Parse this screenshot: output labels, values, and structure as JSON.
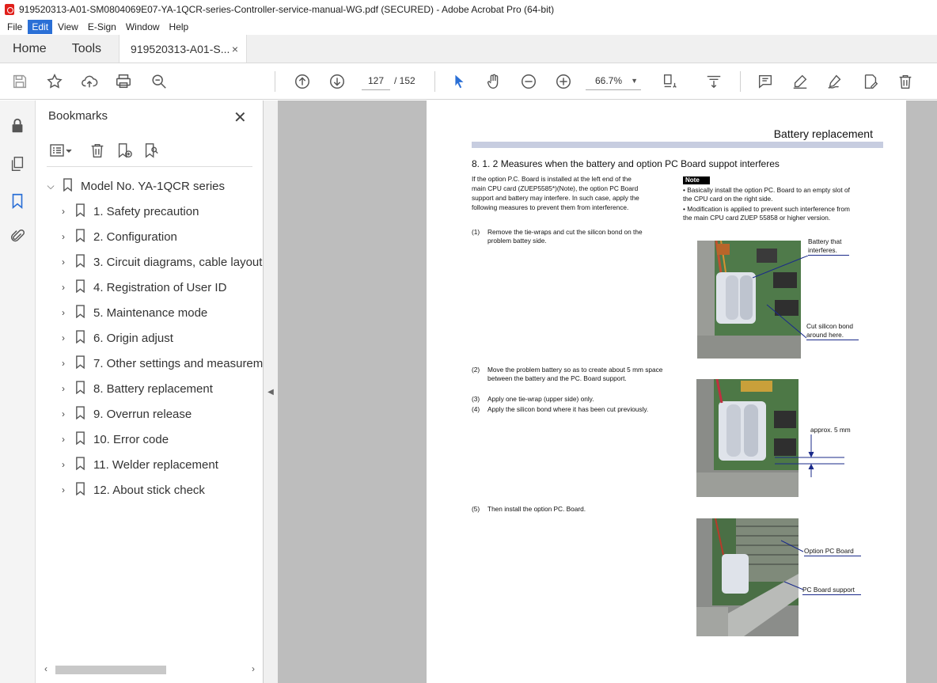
{
  "window": {
    "title": "919520313-A01-SM0804069E07-YA-1QCR-series-Controller-service-manual-WG.pdf (SECURED) - Adobe Acrobat Pro (64-bit)"
  },
  "menu": {
    "items": [
      "File",
      "Edit",
      "View",
      "E-Sign",
      "Window",
      "Help"
    ]
  },
  "tabs": {
    "home": "Home",
    "tools": "Tools",
    "document": "919520313-A01-S...",
    "close": "×"
  },
  "toolbar": {
    "page_current": "127",
    "page_total": "/  152",
    "zoom": "66.7%"
  },
  "bookmarks_panel": {
    "title": "Bookmarks",
    "close": "✕",
    "root": "Model No. YA-1QCR series",
    "items": [
      "1. Safety precaution",
      "2. Configuration",
      "3. Circuit diagrams, cable layout",
      "4. Registration of User ID",
      "5. Maintenance mode",
      "6. Origin adjust",
      "7. Other settings and measurem",
      "8. Battery replacement",
      "9. Overrun release",
      "10. Error code",
      "11. Welder replacement",
      "12. About stick check"
    ]
  },
  "pdf_page": {
    "header": "Battery replacement",
    "section": "8. 1. 2  Measures when the battery and option PC Board suppot interferes",
    "intro_lines": [
      "If the option P.C. Board is installed at the left end of the",
      "main CPU card (ZUEP5585*)(Note), the option PC Board",
      "support and battery may interfere. In such case, apply the",
      "following measures to prevent them from interference."
    ],
    "note_label": "Note",
    "note_lines": [
      "• Basically install the option PC. Board to an empty slot  of",
      "   the CPU card on the right side.",
      "• Modification is applied to prevent such interference from",
      "   the main CPU card ZUEP 55858 or higher version."
    ],
    "steps": [
      {
        "num": "(1)",
        "text": "Remove the tie-wraps and cut the silicon bond on the problem battey side."
      },
      {
        "num": "(2)",
        "text": "Move the problem battery so as to create about 5 mm space between the battery and the PC. Board support."
      },
      {
        "num": "(3)",
        "text": "Apply one tie-wrap (upper side) only."
      },
      {
        "num": "(4)",
        "text": "Apply the silicon bond where it has been cut previously."
      },
      {
        "num": "(5)",
        "text": "Then install the option PC. Board."
      }
    ],
    "callouts": {
      "battery_interferes": [
        "Battery that",
        "interferes."
      ],
      "cut_silicon": [
        "Cut silicon bond",
        "around here."
      ],
      "approx": "approx. 5 mm",
      "option_board": "Option PC Board",
      "board_support": "PC Board support"
    }
  }
}
